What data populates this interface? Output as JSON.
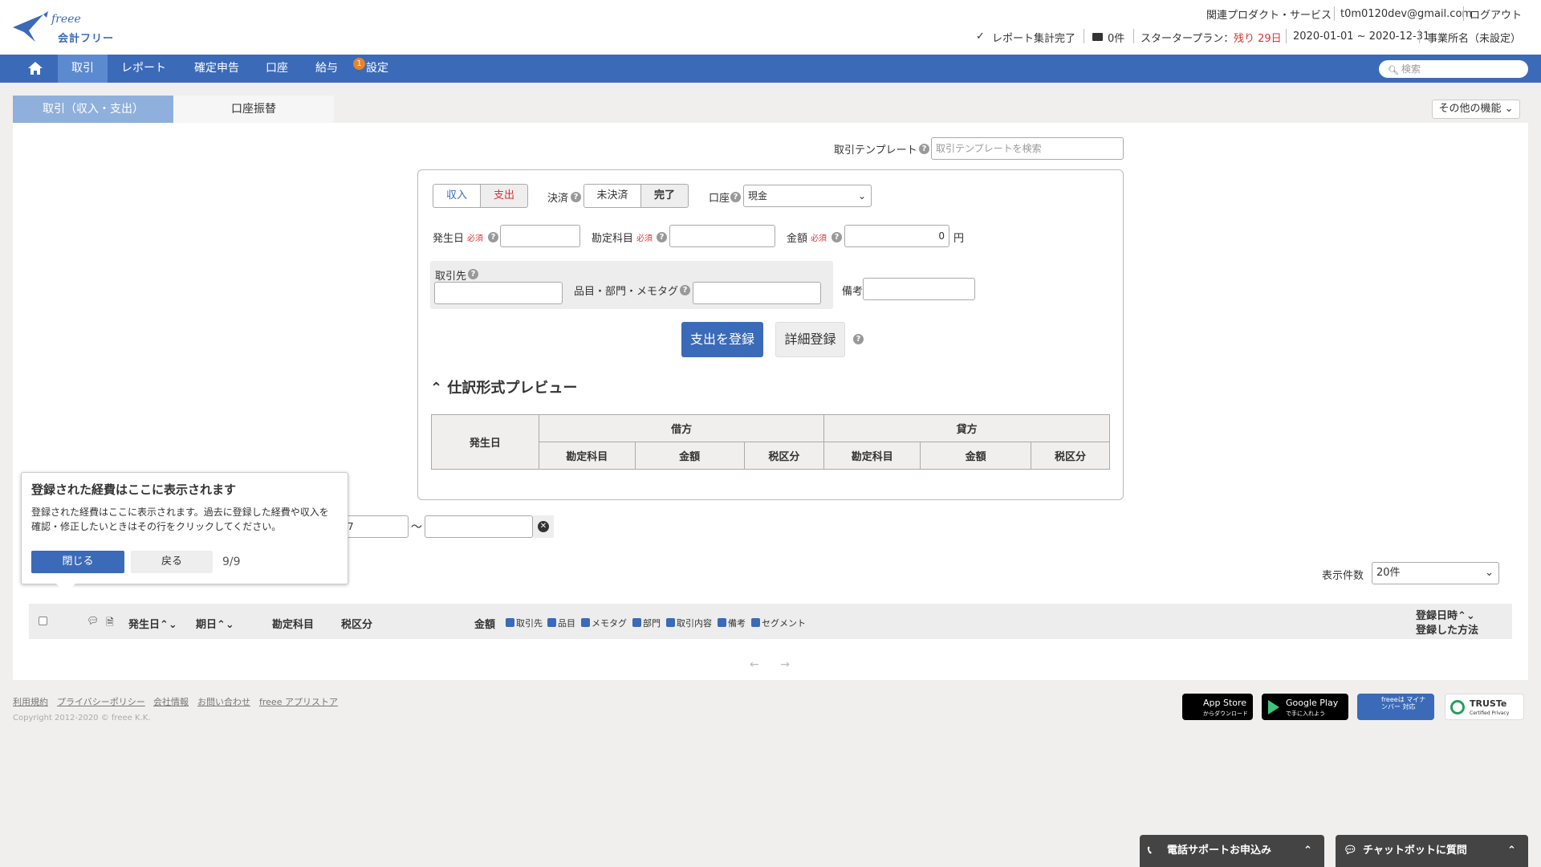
{
  "header": {
    "logo_text": "freee",
    "logo_subtext": "会計フリー",
    "related_products": "関連プロダクト・サービス",
    "email": "t0m0120dev@gmail.com",
    "logout": "ログアウト",
    "report_status": "レポート集計完了",
    "message_count": "0件",
    "plan_label": "スタータープラン：",
    "plan_remaining": "残り 29日",
    "period": "2020-01-01 ~ 2020-12-31",
    "office_name": "事業所名（未設定）"
  },
  "nav": {
    "items": [
      "取引",
      "レポート",
      "確定申告",
      "口座",
      "給与",
      "設定"
    ],
    "badge": "1",
    "search_placeholder": "検索"
  },
  "tabs": {
    "trade": "取引（収入・支出）",
    "transfer": "口座振替",
    "other_functions": "その他の機能"
  },
  "form": {
    "template_label": "取引テンプレート",
    "template_placeholder": "取引テンプレートを検索",
    "income": "収入",
    "expense": "支出",
    "settlement_label": "決済",
    "unsettled": "未決済",
    "settled": "完了",
    "account_label": "口座",
    "account_value": "現金",
    "date_label": "発生日",
    "required": "必須",
    "account_item_label": "勘定科目",
    "amount_label": "金額",
    "amount_value": "0",
    "yen": "円",
    "partner_label": "取引先",
    "item_label": "品目・部門・メモタグ",
    "note_label": "備考",
    "register_button": "支出を登録",
    "detail_button": "詳細登録"
  },
  "preview": {
    "title": "仕訳形式プレビュー",
    "date_col": "発生日",
    "debit": "借方",
    "credit": "貸方",
    "account": "勘定科目",
    "amount": "金額",
    "tax": "税区分"
  },
  "filter": {
    "date_from_value": "7",
    "tilde": "〜"
  },
  "popover": {
    "title": "登録された経費はここに表示されます",
    "body": "登録された経費はここに表示されます。過去に登録した経費や収入を確認・修正したいときはその行をクリックしてください。",
    "close": "閉じる",
    "back": "戻る",
    "count": "9/9"
  },
  "list": {
    "per_page_label": "表示件数",
    "per_page_value": "20件",
    "columns": [
      "発生日",
      "期日",
      "勘定科目",
      "税区分",
      "金額"
    ],
    "toggles": [
      "取引先",
      "品目",
      "メモタグ",
      "部門",
      "取引内容",
      "備考",
      "セグメント"
    ],
    "registered_at": "登録日時",
    "registered_method": "登録した方法"
  },
  "footer": {
    "links": [
      "利用規約",
      "プライバシーポリシー",
      "会社情報",
      "お問い合わせ",
      "freee アプリストア"
    ],
    "copyright": "Copyright 2012-2020 © freee K.K.",
    "app_store": "App Store",
    "app_store_sub": "からダウンロード",
    "google_play": "Google Play",
    "google_play_sub": "で手に入れよう",
    "mynumber": "freeeは マイナンバー 対応",
    "truste": "TRUSTe",
    "truste_sub": "Certified Privacy"
  },
  "bottom": {
    "phone_support": "電話サポートお申込み",
    "chatbot": "チャットボットに質問"
  },
  "colors": {
    "primary": "#3b6ab8",
    "required": "#dd3333",
    "badge": "#e8842a"
  }
}
